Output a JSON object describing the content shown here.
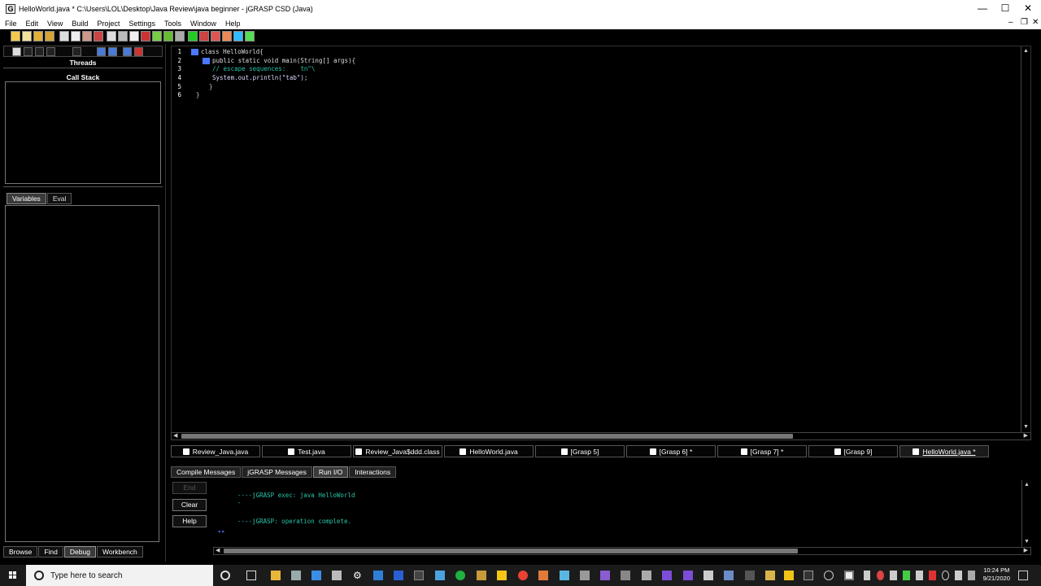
{
  "window": {
    "title": "HelloWorld.java *  C:\\Users\\LOL\\Desktop\\Java Review\\java beginner - jGRASP CSD (Java)",
    "minimize": "—",
    "maximize": "☐",
    "close": "✕"
  },
  "menu": [
    "File",
    "Edit",
    "View",
    "Build",
    "Project",
    "Settings",
    "Tools",
    "Window",
    "Help"
  ],
  "left_panel": {
    "threads_title": "Threads",
    "callstack_title": "Call Stack",
    "tabs": [
      "Variables",
      "Eval"
    ],
    "bottom_tabs": [
      "Browse",
      "Find",
      "Debug",
      "Workbench"
    ],
    "active_bottom_tab": "Debug"
  },
  "editor": {
    "line_numbers": [
      "1",
      "2",
      "3",
      "4",
      "5",
      "6"
    ],
    "lines": [
      "class HelloWorld{",
      "public static void main(String[] args){",
      "// escape sequences:    tn\"\\",
      "System.out.println(\"tab\");",
      "}",
      "}"
    ]
  },
  "file_tabs": [
    {
      "label": "Review_Java.java",
      "selected": false
    },
    {
      "label": "Test.java",
      "selected": false
    },
    {
      "label": "Review_Java$ddd.class",
      "selected": false
    },
    {
      "label": "HelloWorld.java",
      "selected": false
    },
    {
      "label": "[Grasp 5]",
      "selected": false
    },
    {
      "label": "[Grasp 6] *",
      "selected": false
    },
    {
      "label": "[Grasp 7] *",
      "selected": false
    },
    {
      "label": "[Grasp 9]",
      "selected": false
    },
    {
      "label": "HelloWorld.java *",
      "selected": true
    }
  ],
  "message_tabs": [
    "Compile Messages",
    "jGRASP Messages",
    "Run I/O",
    "Interactions"
  ],
  "active_message_tab": "Run I/O",
  "io": {
    "buttons": [
      "End",
      "Clear",
      "Help"
    ],
    "lines": [
      "----jGRASP exec: java HelloWorld",
      "-",
      "----jGRASP: operation complete."
    ],
    "prompt": "▸▸"
  },
  "taskbar": {
    "search_placeholder": "Type here to search",
    "time": "10:24 PM",
    "date": "9/21/2020"
  }
}
